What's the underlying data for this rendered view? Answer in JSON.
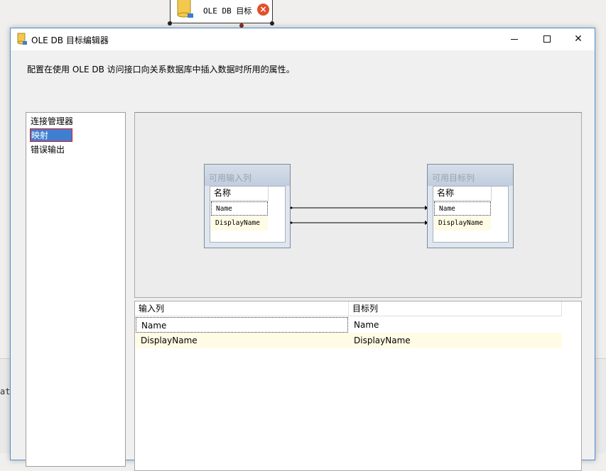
{
  "background": {
    "node_label": "OLE DB 目标",
    "side_text": "at",
    "error_icon": "error-x-icon"
  },
  "dialog": {
    "title": "OLE DB 目标编辑器",
    "description": "配置在使用 OLE DB 访问接口向关系数据库中插入数据时所用的属性。",
    "nav": {
      "items": [
        {
          "label": "连接管理器"
        },
        {
          "label": "映射"
        },
        {
          "label": "错误输出"
        }
      ]
    },
    "mapping": {
      "input_table": {
        "title": "可用输入列",
        "column_header": "名称",
        "rows": [
          "Name",
          "DisplayName"
        ]
      },
      "dest_table": {
        "title": "可用目标列",
        "column_header": "名称",
        "rows": [
          "Name",
          "DisplayName"
        ]
      }
    },
    "grid": {
      "headers": [
        "输入列",
        "目标列"
      ],
      "rows": [
        [
          "Name",
          "Name"
        ],
        [
          "DisplayName",
          "DisplayName"
        ]
      ]
    }
  },
  "colors": {
    "selection": "#3f7fd1",
    "highlight_row": "#fffbe5",
    "error_icon": "#e0522b"
  }
}
